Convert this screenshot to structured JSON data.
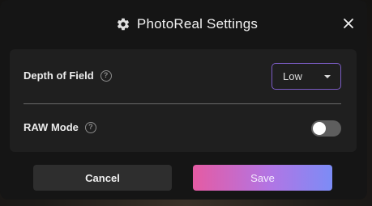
{
  "dialog": {
    "title": "PhotoReal Settings",
    "icon": "gear-icon",
    "close_icon": "close-icon"
  },
  "settings": {
    "depth_of_field": {
      "label": "Depth of Field",
      "help_icon": "help-icon",
      "selected": "Low"
    },
    "raw_mode": {
      "label": "RAW Mode",
      "help_icon": "help-icon",
      "enabled": false
    }
  },
  "actions": {
    "cancel_label": "Cancel",
    "save_label": "Save"
  },
  "colors": {
    "accent_border": "#7b5cc4",
    "save_gradient_start": "#e55ba3",
    "save_gradient_end": "#7c8cf6"
  }
}
